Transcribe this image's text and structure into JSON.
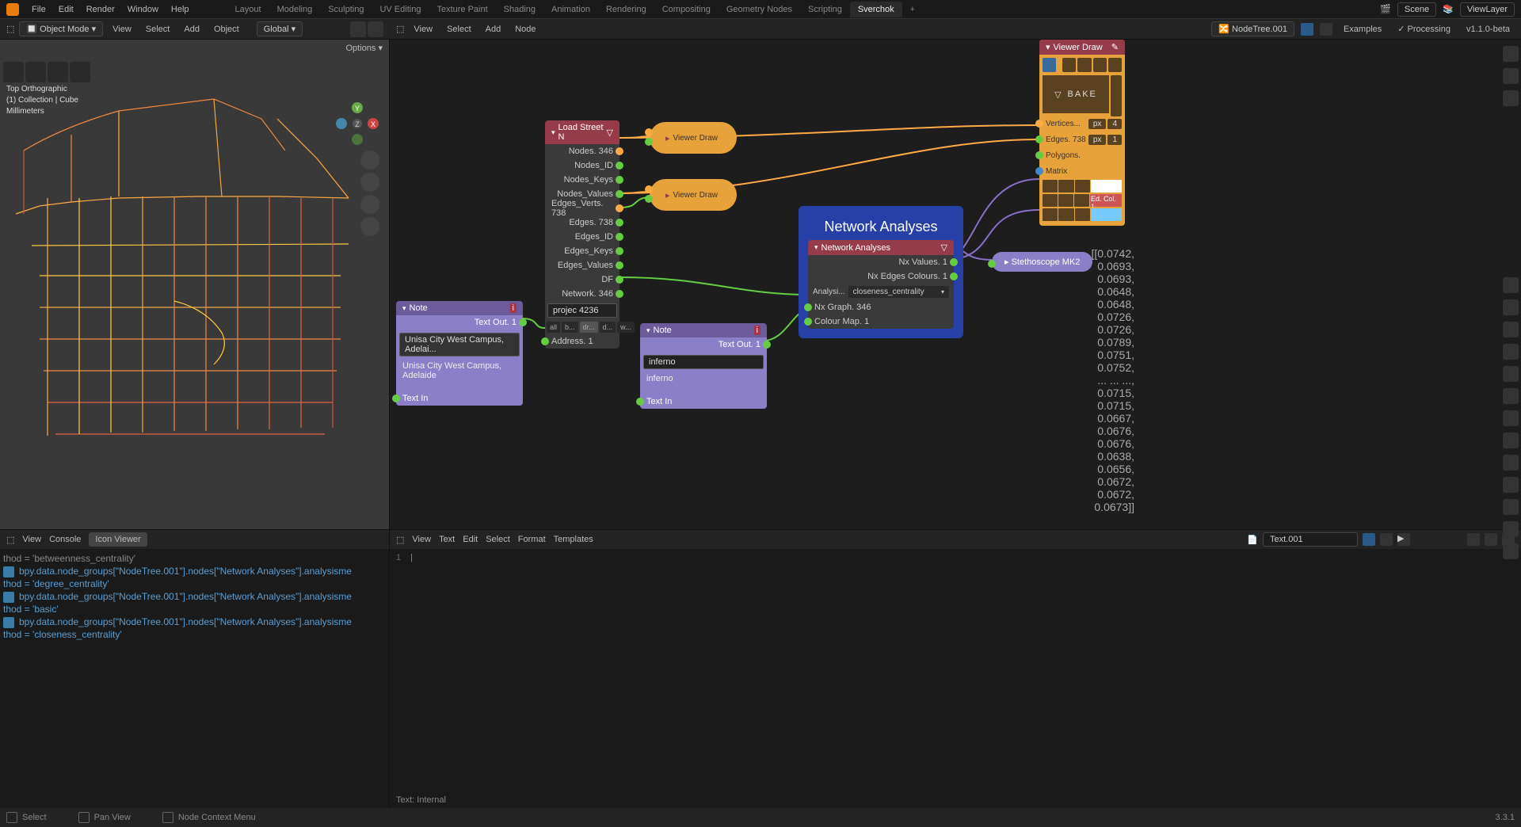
{
  "menubar": {
    "items": [
      "File",
      "Edit",
      "Render",
      "Window",
      "Help"
    ],
    "tabs": [
      "Layout",
      "Modeling",
      "Sculpting",
      "UV Editing",
      "Texture Paint",
      "Shading",
      "Animation",
      "Rendering",
      "Compositing",
      "Geometry Nodes",
      "Scripting",
      "Sverchok"
    ],
    "active_tab": "Sverchok",
    "scene_label": "Scene",
    "viewlayer_label": "ViewLayer"
  },
  "viewport_toolbar": {
    "mode": "Object Mode",
    "items": [
      "View",
      "Select",
      "Add",
      "Object"
    ],
    "orientation": "Global",
    "options_label": "Options"
  },
  "viewport_info": {
    "line1": "Top Orthographic",
    "line2": "(1) Collection | Cube",
    "line3": "Millimeters"
  },
  "node_editor_toolbar": {
    "items": [
      "View",
      "Select",
      "Add",
      "Node"
    ],
    "tree_name": "NodeTree.001",
    "examples": "Examples",
    "processing": "Processing",
    "version": "v1.1.0-beta"
  },
  "nodes": {
    "load_street": {
      "title": "Load Street N",
      "outputs": [
        "Nodes. 346",
        "Nodes_ID",
        "Nodes_Keys",
        "Nodes_Values",
        "Edges_Verts. 738",
        "Edges. 738",
        "Edges_ID",
        "Edges_Keys",
        "Edges_Values",
        "DF",
        "Network. 346"
      ],
      "project": "projec   4236",
      "btns": [
        "all",
        "b...",
        "dr...",
        "d...",
        "w..."
      ],
      "input": "Address. 1"
    },
    "viewer_draw_1": "Viewer Draw",
    "viewer_draw_2": "Viewer Draw",
    "note1": {
      "title": "Note",
      "output": "Text Out. 1",
      "value": "Unisa City West Campus, Adelai...",
      "display": "Unisa City West Campus, Adelaide",
      "input": "Text In"
    },
    "note2": {
      "title": "Note",
      "output": "Text Out. 1",
      "value": "inferno",
      "display": "inferno",
      "input": "Text In"
    },
    "network_frame": {
      "title": "Network Analyses"
    },
    "network_analyses": {
      "title": "Network Analyses",
      "outputs": [
        "Nx Values. 1",
        "Nx Edges Colours. 1"
      ],
      "analysis_label": "Analysi...",
      "analysis_value": "closeness_centrality",
      "inputs": [
        "Nx Graph. 346",
        "Colour Map. 1"
      ]
    },
    "stethoscope": "Stethoscope MK2",
    "viewer_draw_big": {
      "title": "Viewer Draw",
      "bake": "BAKE",
      "props": [
        {
          "label": "Vertices...",
          "unit": "px",
          "val": "4"
        },
        {
          "label": "Edges. 738",
          "unit": "px",
          "val": "1"
        },
        {
          "label": "Polygons.",
          "unit": "",
          "val": ""
        },
        {
          "label": "Matrix",
          "unit": "",
          "val": ""
        }
      ],
      "ed_col": "Ed. Col. 1"
    }
  },
  "stethoscope_output": [
    "[[0.0742,",
    "0.0693,",
    "0.0693,",
    "0.0648,",
    "0.0648,",
    "0.0726,",
    "0.0726,",
    "0.0789,",
    "0.0751,",
    "0.0752,",
    "... ... ...,",
    "0.0715,",
    "0.0715,",
    "0.0667,",
    "0.0676,",
    "0.0676,",
    "0.0638,",
    "0.0656,",
    "0.0672,",
    "0.0672,",
    "0.0673]]"
  ],
  "console": {
    "items": [
      "View",
      "Console",
      "Icon Viewer"
    ],
    "lines": [
      "thod = 'betweenness_centrality'",
      "bpy.data.node_groups[\"NodeTree.001\"].nodes[\"Network Analyses\"].analysisme",
      "thod = 'degree_centrality'",
      "bpy.data.node_groups[\"NodeTree.001\"].nodes[\"Network Analyses\"].analysisme",
      "thod = 'basic'",
      "bpy.data.node_groups[\"NodeTree.001\"].nodes[\"Network Analyses\"].analysisme",
      "thod = 'closeness_centrality'"
    ]
  },
  "texteditor": {
    "items": [
      "View",
      "Text",
      "Edit",
      "Select",
      "Format",
      "Templates"
    ],
    "name": "Text.001",
    "footer": "Text: Internal"
  },
  "statusbar": {
    "select": "Select",
    "pan": "Pan View",
    "context": "Node Context Menu",
    "version": "3.3.1"
  }
}
